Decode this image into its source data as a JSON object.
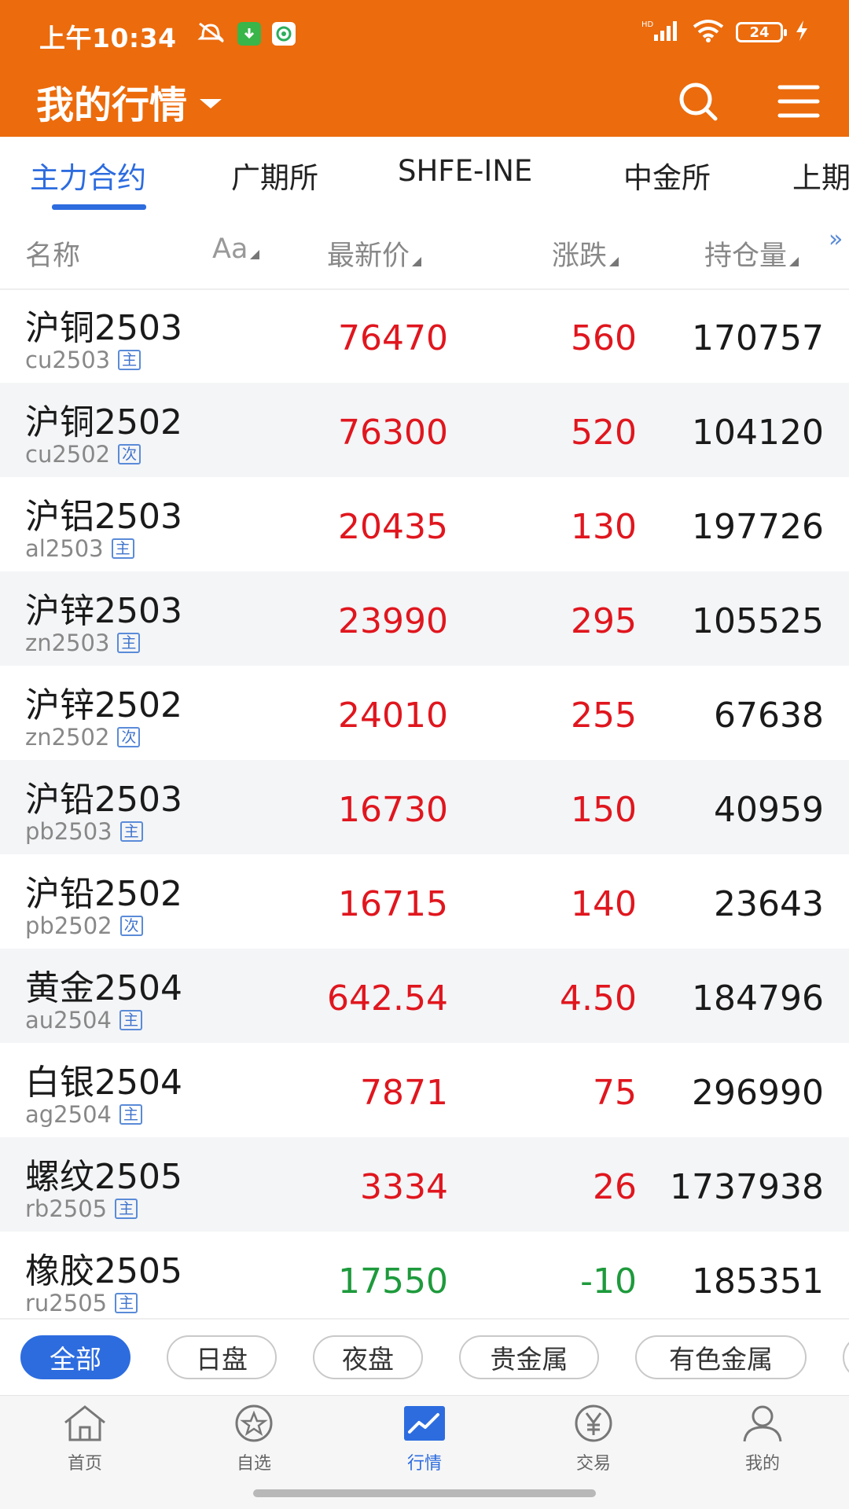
{
  "status_bar": {
    "time": "上午10:34",
    "battery": "24"
  },
  "header": {
    "title": "我的行情"
  },
  "tabs": [
    "主力合约",
    "广期所",
    "SHFE-INE",
    "中金所",
    "上期"
  ],
  "columns": {
    "name": "名称",
    "font_toggle": "Aa",
    "price": "最新价",
    "change": "涨跌",
    "open_interest": "持仓量",
    "more": "»"
  },
  "rows": [
    {
      "name": "沪铜2503",
      "code": "cu2503",
      "tag": "主",
      "price": "76470",
      "change": "560",
      "open_interest": "170757",
      "dir": "up"
    },
    {
      "name": "沪铜2502",
      "code": "cu2502",
      "tag": "次",
      "price": "76300",
      "change": "520",
      "open_interest": "104120",
      "dir": "up"
    },
    {
      "name": "沪铝2503",
      "code": "al2503",
      "tag": "主",
      "price": "20435",
      "change": "130",
      "open_interest": "197726",
      "dir": "up"
    },
    {
      "name": "沪锌2503",
      "code": "zn2503",
      "tag": "主",
      "price": "23990",
      "change": "295",
      "open_interest": "105525",
      "dir": "up"
    },
    {
      "name": "沪锌2502",
      "code": "zn2502",
      "tag": "次",
      "price": "24010",
      "change": "255",
      "open_interest": "67638",
      "dir": "up"
    },
    {
      "name": "沪铅2503",
      "code": "pb2503",
      "tag": "主",
      "price": "16730",
      "change": "150",
      "open_interest": "40959",
      "dir": "up"
    },
    {
      "name": "沪铅2502",
      "code": "pb2502",
      "tag": "次",
      "price": "16715",
      "change": "140",
      "open_interest": "23643",
      "dir": "up"
    },
    {
      "name": "黄金2504",
      "code": "au2504",
      "tag": "主",
      "price": "642.54",
      "change": "4.50",
      "open_interest": "184796",
      "dir": "up"
    },
    {
      "name": "白银2504",
      "code": "ag2504",
      "tag": "主",
      "price": "7871",
      "change": "75",
      "open_interest": "296990",
      "dir": "up"
    },
    {
      "name": "螺纹2505",
      "code": "rb2505",
      "tag": "主",
      "price": "3334",
      "change": "26",
      "open_interest": "1737938",
      "dir": "up"
    },
    {
      "name": "橡胶2505",
      "code": "ru2505",
      "tag": "主",
      "price": "17550",
      "change": "-10",
      "open_interest": "185351",
      "dir": "down"
    }
  ],
  "filters": [
    "全部",
    "日盘",
    "夜盘",
    "贵金属",
    "有色金属"
  ],
  "bottom_nav": [
    "首页",
    "自选",
    "行情",
    "交易",
    "我的"
  ],
  "colors": {
    "brand": "#EC6B0C",
    "accent": "#2D6CDF",
    "up": "#E0161E",
    "down": "#1E9A3C"
  },
  "icons": [
    "search-icon",
    "menu-icon",
    "home-icon",
    "star-icon",
    "chart-icon",
    "yen-icon",
    "user-icon"
  ]
}
